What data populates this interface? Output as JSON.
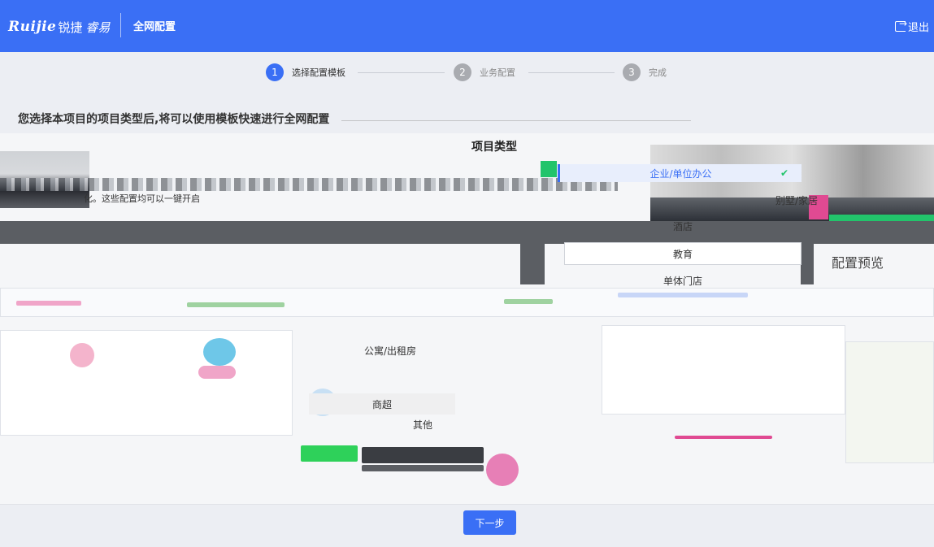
{
  "header": {
    "brand": "Ruijie",
    "brand_cn": "锐捷",
    "product": "睿易",
    "title": "全网配置",
    "logout": "退出"
  },
  "steps": [
    {
      "number": "1",
      "label": "选择配置模板",
      "state": "active"
    },
    {
      "number": "2",
      "label": "业务配置",
      "state": "inactive"
    },
    {
      "number": "3",
      "label": "完成",
      "state": "inactive"
    }
  ],
  "intro": "您选择本项目的项目类型后,将可以使用模板快速进行全网配置",
  "description": "化。这些配置均可以一键开启",
  "project_type": {
    "title": "项目类型",
    "options": [
      {
        "label": "企业/单位办公",
        "selected": true
      },
      {
        "label": "别墅/家居",
        "selected": false
      },
      {
        "label": "酒店",
        "selected": false
      },
      {
        "label": "教育",
        "selected": false
      },
      {
        "label": "单体门店",
        "selected": false
      },
      {
        "label": "公寓/出租房",
        "selected": false
      },
      {
        "label": "商超",
        "selected": false
      },
      {
        "label": "其他",
        "selected": false
      }
    ]
  },
  "preview_label": "配置预览",
  "next_button": "下一步",
  "colors": {
    "primary": "#3a6ff5",
    "success": "#22c46b",
    "accent_pink": "#e04a92"
  }
}
